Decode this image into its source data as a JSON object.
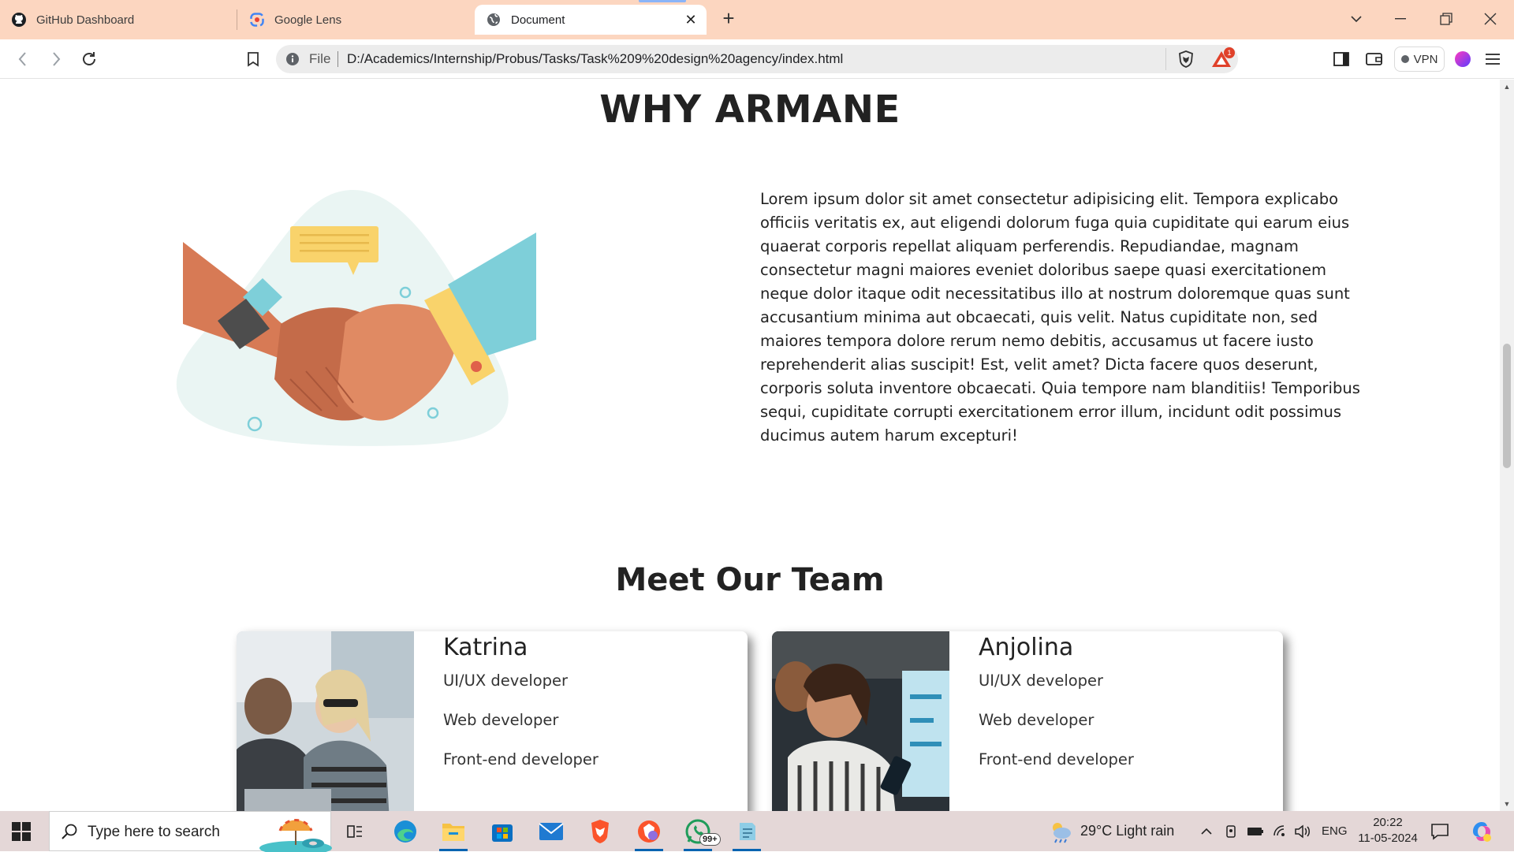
{
  "browser": {
    "tabs": [
      {
        "title": "GitHub Dashboard",
        "icon": "github-icon"
      },
      {
        "title": "Google Lens",
        "icon": "google-lens-icon"
      },
      {
        "title": "Document",
        "icon": "globe-icon",
        "active": true
      }
    ],
    "address": {
      "scheme_label": "File",
      "url": "D:/Academics/Internship/Probus/Tasks/Task%209%20design%20agency/index.html"
    },
    "rewards_badge": "1",
    "vpn_label": "VPN"
  },
  "page": {
    "why_title": "WHY ARMANE",
    "why_text": "Lorem ipsum dolor sit amet consectetur adipisicing elit. Tempora explicabo officiis veritatis ex, aut eligendi dolorum fuga quia cupiditate qui earum eius quaerat corporis repellat aliquam perferendis. Repudiandae, magnam consectetur magni maiores eveniet doloribus saepe quasi exercitationem neque dolor itaque odit necessitatibus illo at nostrum doloremque quas sunt accusantium minima aut obcaecati, quis velit. Natus cupiditate non, sed maiores tempora dolore rerum nemo debitis, accusamus ut facere iusto reprehenderit alias suscipit! Est, velit amet? Dicta facere quos deserunt, corporis soluta inventore obcaecati. Quia tempore nam blanditiis! Temporibus sequi, cupiditate corrupti exercitationem error illum, incidunt odit possimus ducimus autem harum excepturi!",
    "team_title": "Meet Our Team",
    "team": [
      {
        "name": "Katrina",
        "roles": [
          "UI/UX developer",
          "Web developer",
          "Front-end developer"
        ]
      },
      {
        "name": "Anjolina",
        "roles": [
          "UI/UX developer",
          "Web developer",
          "Front-end developer"
        ]
      }
    ]
  },
  "taskbar": {
    "search_placeholder": "Type here to search",
    "whatsapp_badge": "99+",
    "weather": "29°C  Light rain",
    "language": "ENG",
    "time": "20:22",
    "date": "11-05-2024"
  },
  "colors": {
    "tabbar_bg": "#fcd6c0",
    "taskbar_bg": "#e4d7d7",
    "hand_left": "#d77a55",
    "sleeve_right": "#7ecfd9",
    "cuff": "#f9d36b"
  }
}
